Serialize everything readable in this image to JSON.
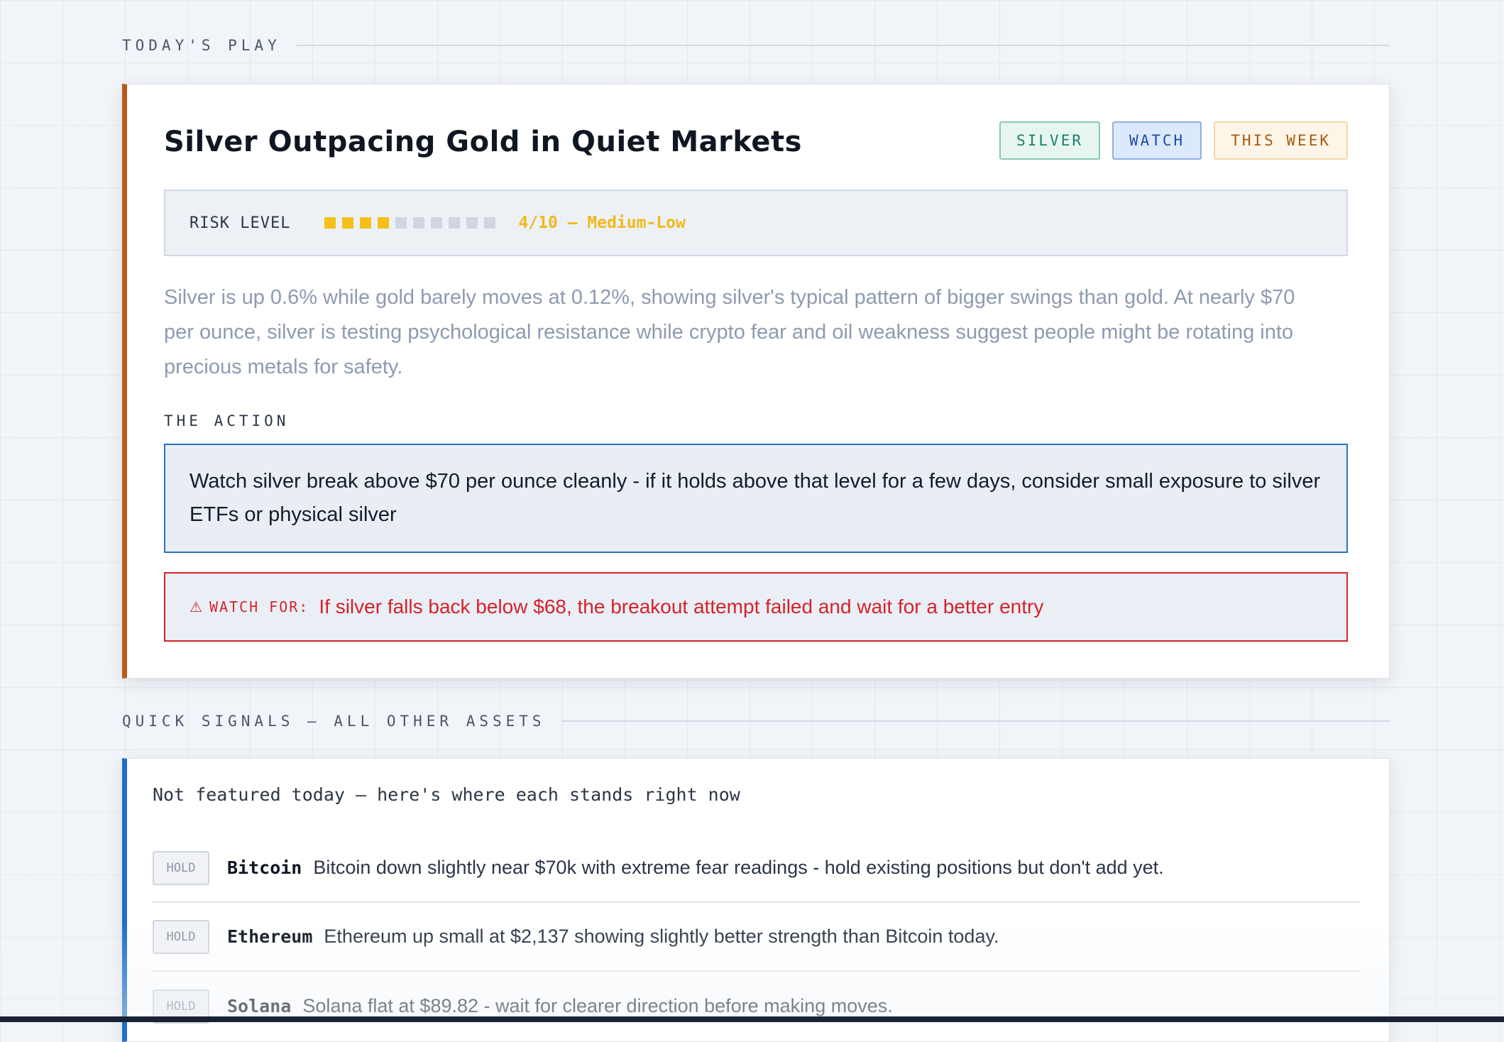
{
  "sections": {
    "play_label": "TODAY'S PLAY",
    "signals_label": "QUICK SIGNALS — ALL OTHER ASSETS"
  },
  "play": {
    "title": "Silver Outpacing Gold in Quiet Markets",
    "tags": {
      "asset": "SILVER",
      "stance": "WATCH",
      "timeframe": "THIS WEEK"
    },
    "risk": {
      "label": "RISK LEVEL",
      "level": 4,
      "max": 10,
      "value_text": "4/10 — Medium-Low"
    },
    "summary": "Silver is up 0.6% while gold barely moves at 0.12%, showing silver's typical pattern of bigger swings than gold. At nearly $70 per ounce, silver is testing psychological resistance while crypto fear and oil weakness suggest people might be rotating into precious metals for safety.",
    "action_label": "THE ACTION",
    "action_text": "Watch silver break above $70 per ounce cleanly - if it holds above that level for a few days, consider small exposure to silver ETFs or physical silver",
    "watch_for": {
      "icon": "⚠",
      "label": "WATCH FOR:",
      "text": "If silver falls back below $68, the breakout attempt failed and wait for a better entry"
    }
  },
  "signals": {
    "intro": "Not featured today — here's where each stands right now",
    "items": [
      {
        "badge": "HOLD",
        "asset": "Bitcoin",
        "text": "Bitcoin down slightly near $70k with extreme fear readings - hold existing positions but don't add yet."
      },
      {
        "badge": "HOLD",
        "asset": "Ethereum",
        "text": "Ethereum up small at $2,137 showing slightly better strength than Bitcoin today."
      },
      {
        "badge": "HOLD",
        "asset": "Solana",
        "text": "Solana flat at $89.82 - wait for clearer direction before making moves."
      }
    ]
  },
  "colors": {
    "play_accent": "#b85a18",
    "signals_accent": "#1f6fc9",
    "risk_on": "#f5c01a",
    "warning_red": "#d3232b"
  }
}
